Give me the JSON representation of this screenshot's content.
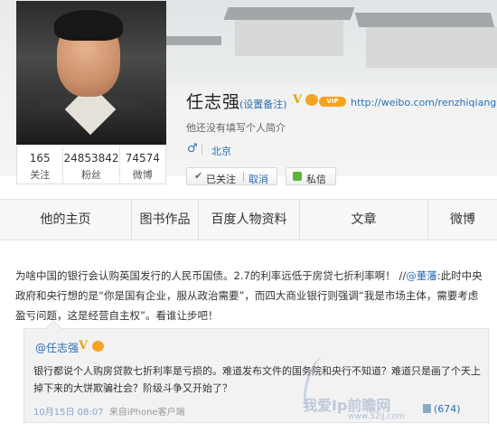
{
  "profile": {
    "name": "任志强",
    "remark": "(设置备注)",
    "vip_badge": "VIP",
    "url": "http://weibo.com/renzhiqiang",
    "intro": "他还没有填写个人简介",
    "gender_icon": "♂",
    "city": "北京",
    "stats": [
      {
        "value": "165",
        "label": "关注"
      },
      {
        "value": "24853842",
        "label": "粉丝"
      },
      {
        "value": "74574",
        "label": "微博"
      }
    ],
    "follow": {
      "check": "✔",
      "label": "已关注",
      "cancel": "取消"
    },
    "message_label": "私信"
  },
  "tabs": [
    "他的主页",
    "图书作品",
    "百度人物资料",
    "文章",
    "微博"
  ],
  "post": {
    "text_before": "为啥中国的银行会认购英国发行的人民币国债。2.7的利率远低于房贷七折利率啊！ //",
    "mention": "@董藩",
    "text_after": ":此时中央政府和央行想的是“你是国有企业，服从政治需要”，而四大商业银行则强调“我是市场主体，需要考虑盈亏问题，这是经营自主权”。看谁让步吧！"
  },
  "quote": {
    "author": "@任志强",
    "text": "银行都说个人购房贷款七折利率是亏损的。难道发布文件的国务院和央行不知道？难道只是画了个天上掉下来的大饼欺骗社会？阶级斗争又开始了？",
    "time": "10月15日 08:07",
    "source": "来自iPhone客户端",
    "likes": "(674)"
  },
  "watermark": {
    "text": "我爱Ip前瞻网",
    "sub": "www.52ij.com"
  },
  "colors": {
    "link": "#2b6fb6",
    "vip_orange": "#f6a21a",
    "message_green": "#5db43b"
  }
}
